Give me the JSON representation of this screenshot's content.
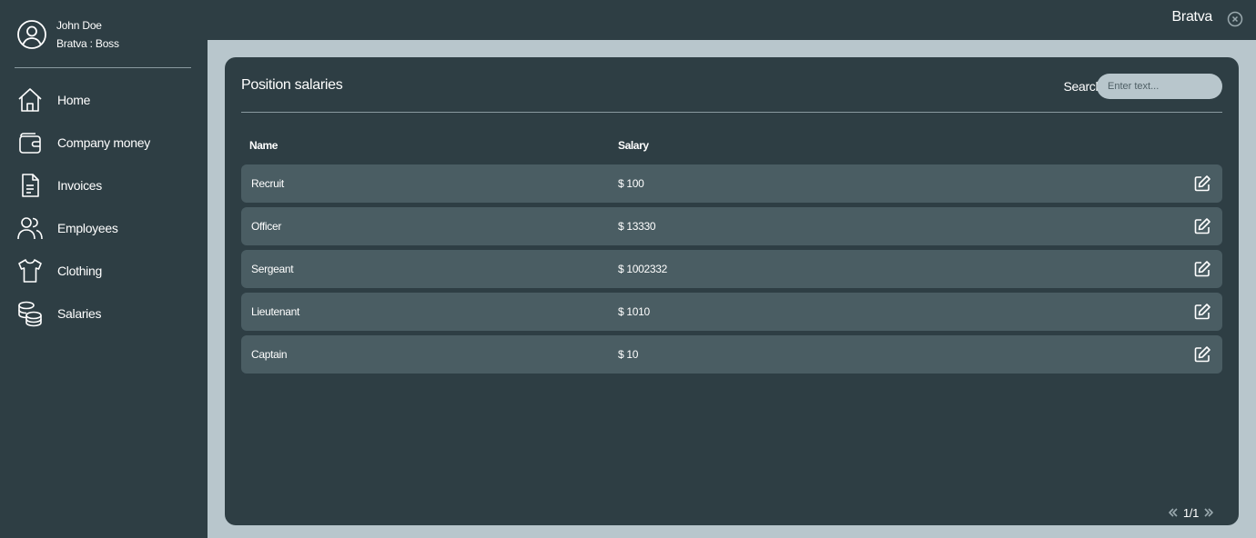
{
  "user": {
    "name": "John Doe",
    "role": "Bratva : Boss"
  },
  "nav": [
    {
      "label": "Home",
      "icon": "home-icon"
    },
    {
      "label": "Company money",
      "icon": "wallet-icon"
    },
    {
      "label": "Invoices",
      "icon": "invoice-icon"
    },
    {
      "label": "Employees",
      "icon": "users-icon"
    },
    {
      "label": "Clothing",
      "icon": "shirt-icon"
    },
    {
      "label": "Salaries",
      "icon": "coins-icon"
    }
  ],
  "topbar": {
    "title": "Bratva"
  },
  "panel": {
    "title": "Position salaries",
    "search_label": "Search",
    "search_placeholder": "Enter text...",
    "columns": {
      "name": "Name",
      "salary": "Salary"
    },
    "rows": [
      {
        "name": "Recruit",
        "salary": "$ 100"
      },
      {
        "name": "Officer",
        "salary": "$ 13330"
      },
      {
        "name": "Sergeant",
        "salary": "$ 1002332"
      },
      {
        "name": "Lieutenant",
        "salary": "$ 1010"
      },
      {
        "name": "Captain",
        "salary": "$ 10"
      }
    ],
    "pager": "1/1"
  },
  "colors": {
    "sidebar_bg": "#2e3e44",
    "main_bg": "#b8c6cc",
    "row_bg": "#4a5d63",
    "text": "#ffffff"
  }
}
